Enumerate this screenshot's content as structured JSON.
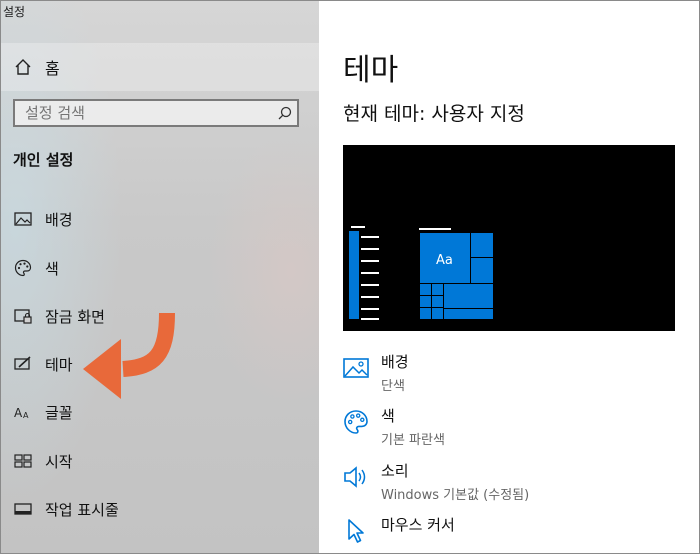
{
  "app": {
    "title": "설정"
  },
  "sidebar": {
    "home_label": "홈",
    "search_placeholder": "설정 검색",
    "section_title": "개인 설정",
    "items": [
      {
        "label": "배경",
        "icon": "picture-icon"
      },
      {
        "label": "색",
        "icon": "palette-icon"
      },
      {
        "label": "잠금 화면",
        "icon": "lock-screen-icon"
      },
      {
        "label": "테마",
        "icon": "theme-brush-icon",
        "selected": true
      },
      {
        "label": "글꼴",
        "icon": "font-icon"
      },
      {
        "label": "시작",
        "icon": "start-tiles-icon"
      },
      {
        "label": "작업 표시줄",
        "icon": "taskbar-icon"
      }
    ]
  },
  "main": {
    "title": "테마",
    "current_theme": "현재 테마: 사용자 지정",
    "preview": {
      "sample_text": "Aa",
      "background": "#000000",
      "accent": "#0078d7"
    },
    "settings": [
      {
        "label": "배경",
        "value": "단색",
        "icon": "picture-icon"
      },
      {
        "label": "색",
        "value": "기본 파란색",
        "icon": "palette-icon"
      },
      {
        "label": "소리",
        "value": "Windows 기본값 (수정됨)",
        "icon": "speaker-icon"
      },
      {
        "label": "마우스 커서",
        "value": "",
        "icon": "cursor-icon"
      }
    ]
  },
  "colors": {
    "accent": "#0078d7",
    "arrow": "#e8693a"
  }
}
